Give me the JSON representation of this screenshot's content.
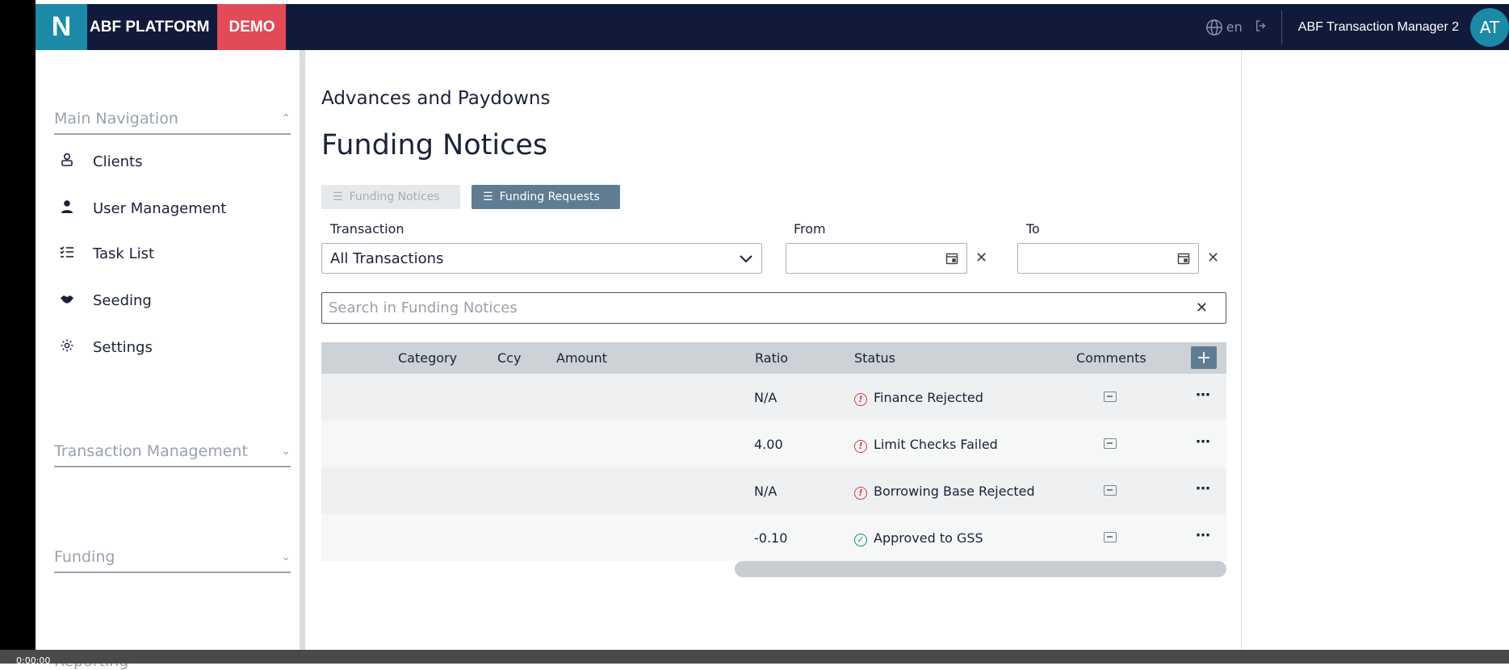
{
  "header": {
    "logo_letter": "N",
    "platform": "ABF PLATFORM",
    "env_badge": "DEMO",
    "lang": "en",
    "user_name": "ABF Transaction Manager 2",
    "avatar_initials": "AT",
    "colors": {
      "bar": "#111a3a",
      "logo": "#1a8aa6",
      "badge": "#e24a57"
    }
  },
  "sidebar": {
    "main_nav_title": "Main Navigation",
    "items": [
      {
        "label": "Clients",
        "icon": "user-badge-icon"
      },
      {
        "label": "User Management",
        "icon": "user-icon"
      },
      {
        "label": "Task List",
        "icon": "checklist-icon"
      },
      {
        "label": "Seeding",
        "icon": "handshake-icon"
      },
      {
        "label": "Settings",
        "icon": "gear-icon"
      }
    ],
    "sections": {
      "transaction_management": "Transaction Management",
      "funding": "Funding",
      "reporting": "Reporting"
    }
  },
  "page": {
    "breadcrumb": "Advances and Paydowns",
    "title": "Funding Notices",
    "tabs": {
      "funding_notices": "Funding Notices",
      "funding_requests": "Funding Requests"
    },
    "filters": {
      "transaction_label": "Transaction",
      "transaction_value": "All Transactions",
      "from_label": "From",
      "to_label": "To"
    },
    "search_placeholder": "Search in Funding Notices"
  },
  "table": {
    "columns": {
      "category": "Category",
      "ccy": "Ccy",
      "amount": "Amount",
      "ratio": "Ratio",
      "status": "Status",
      "comments": "Comments"
    },
    "add_label": "+",
    "rows": [
      {
        "ratio": "N/A",
        "status": "Finance Rejected",
        "status_type": "error"
      },
      {
        "ratio": "4.00",
        "status": "Limit Checks Failed",
        "status_type": "error"
      },
      {
        "ratio": "N/A",
        "status": "Borrowing Base Rejected",
        "status_type": "error"
      },
      {
        "ratio": "-0.10",
        "status": "Approved to GSS",
        "status_type": "ok"
      }
    ]
  },
  "footer": {
    "time": "0:00:00"
  }
}
